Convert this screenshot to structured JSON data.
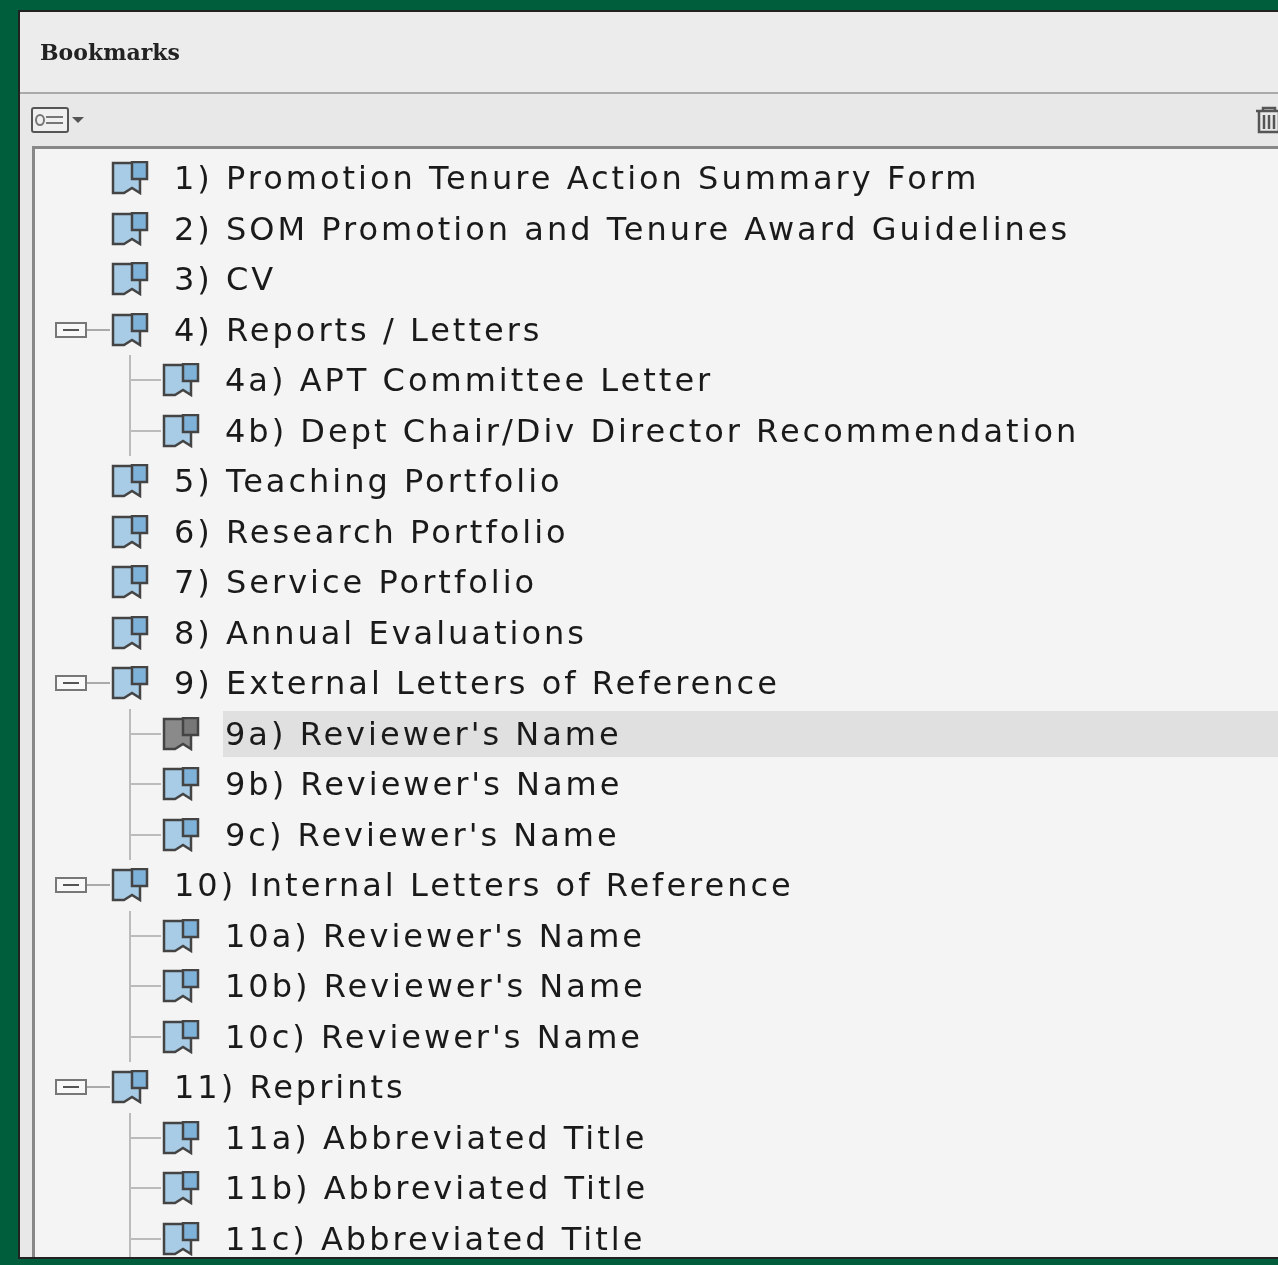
{
  "panel": {
    "title": "Bookmarks"
  },
  "bookmarks": [
    {
      "label": "1) Promotion Tenure Action Summary Form",
      "selected": false
    },
    {
      "label": "2) SOM Promotion and Tenure Award Guidelines",
      "selected": false
    },
    {
      "label": "3) CV",
      "selected": false
    },
    {
      "label": "4) Reports / Letters",
      "selected": false,
      "expanded": true,
      "children": [
        {
          "label": "4a) APT Committee Letter",
          "selected": false
        },
        {
          "label": "4b) Dept Chair/Div Director Recommendation",
          "selected": false
        }
      ]
    },
    {
      "label": "5) Teaching Portfolio",
      "selected": false
    },
    {
      "label": "6) Research Portfolio",
      "selected": false
    },
    {
      "label": "7) Service Portfolio",
      "selected": false
    },
    {
      "label": "8) Annual Evaluations",
      "selected": false
    },
    {
      "label": "9) External Letters of Reference",
      "selected": false,
      "expanded": true,
      "children": [
        {
          "label": "9a) Reviewer's Name",
          "selected": true
        },
        {
          "label": "9b) Reviewer's Name",
          "selected": false
        },
        {
          "label": "9c) Reviewer's Name",
          "selected": false
        }
      ]
    },
    {
      "label": "10) Internal Letters of Reference",
      "selected": false,
      "expanded": true,
      "children": [
        {
          "label": "10a) Reviewer's Name",
          "selected": false
        },
        {
          "label": "10b) Reviewer's Name",
          "selected": false
        },
        {
          "label": "10c) Reviewer's Name",
          "selected": false
        }
      ]
    },
    {
      "label": "11) Reprints",
      "selected": false,
      "expanded": true,
      "children": [
        {
          "label": "11a) Abbreviated Title",
          "selected": false
        },
        {
          "label": "11b) Abbreviated Title",
          "selected": false
        },
        {
          "label": "11c) Abbreviated Title",
          "selected": false
        }
      ]
    }
  ]
}
